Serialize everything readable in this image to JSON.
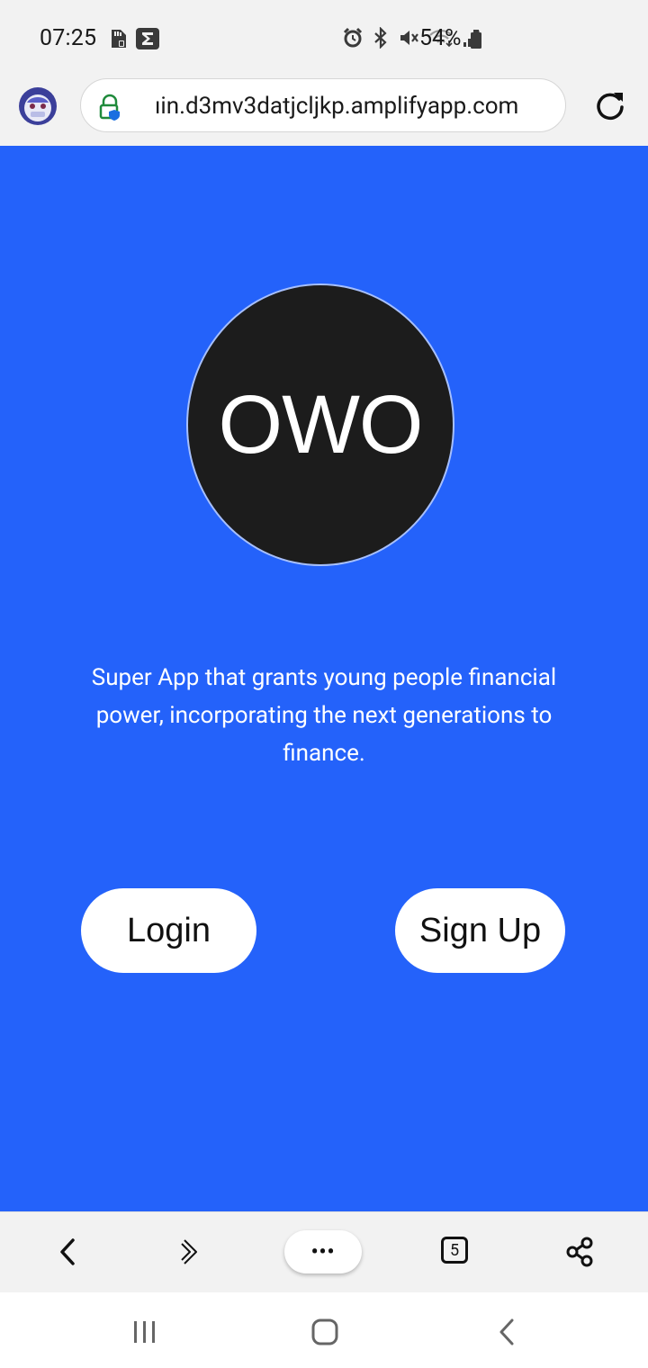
{
  "status_bar": {
    "time": "07:25",
    "battery": "54%",
    "left_icons": [
      "sd-card-icon",
      "sigma-icon"
    ],
    "right_icons": [
      "alarm-icon",
      "bluetooth-icon",
      "mute-icon",
      "wifi-icon",
      "signal-icon",
      "battery-icon"
    ]
  },
  "browser": {
    "url": "ıin.d3mv3datjcljkp.amplifyapp.com",
    "tab_count": "5",
    "menu_label": "•••"
  },
  "page": {
    "logo_text": "OWO",
    "tagline": "Super App that grants young people financial power, incorporating the next generations to finance.",
    "login_label": "Login",
    "signup_label": "Sign Up",
    "background_color": "#2462fa"
  }
}
